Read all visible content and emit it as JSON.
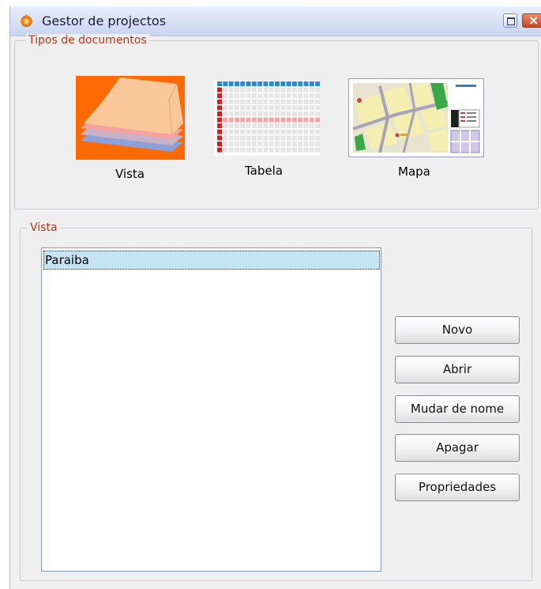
{
  "window": {
    "title": "Gestor de projectos"
  },
  "document_types": {
    "legend": "Tipos de documentos",
    "items": [
      {
        "label": "Vista",
        "icon": "view-layers-icon"
      },
      {
        "label": "Tabela",
        "icon": "table-grid-icon"
      },
      {
        "label": "Mapa",
        "icon": "map-layout-icon"
      }
    ]
  },
  "documents": {
    "legend": "Vista",
    "items": [
      "Paraiba"
    ]
  },
  "actions": {
    "new": "Novo",
    "open": "Abrir",
    "rename": "Mudar de nome",
    "delete": "Apagar",
    "properties": "Propriedades"
  },
  "colors": {
    "legend_text": "#b0391a",
    "selection": "#c4e4f4",
    "view_icon_bg": "#ff6a00"
  }
}
